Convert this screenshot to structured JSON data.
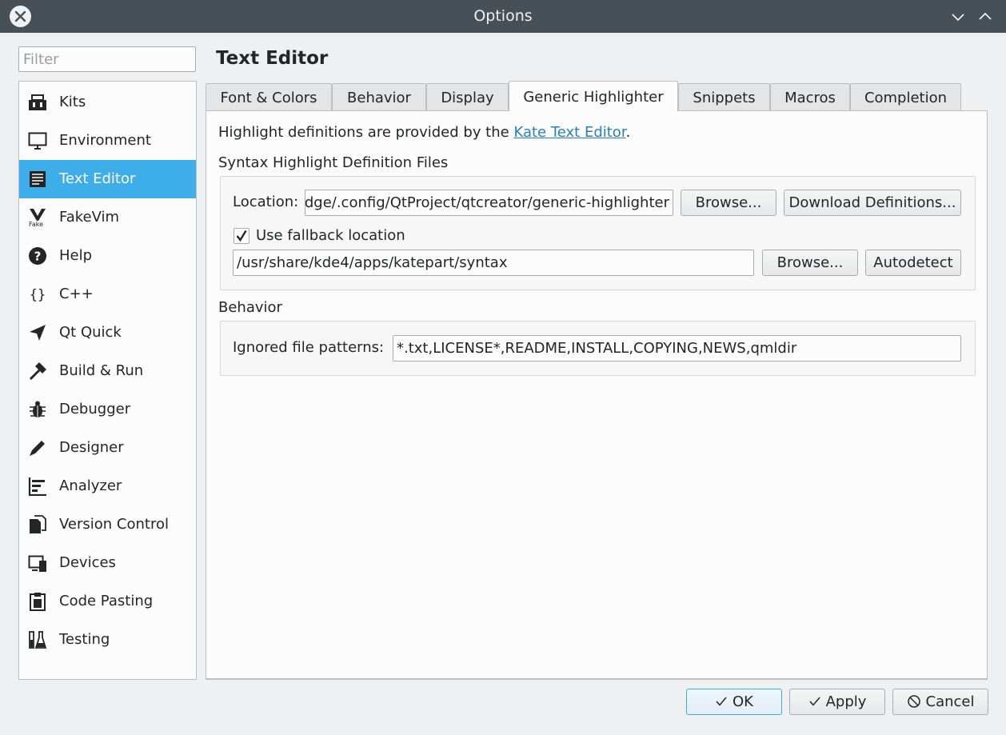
{
  "window": {
    "title": "Options"
  },
  "filter": {
    "placeholder": "Filter",
    "value": ""
  },
  "sidebar": {
    "items": [
      {
        "label": "Kits",
        "icon": "kits-icon"
      },
      {
        "label": "Environment",
        "icon": "monitor-icon"
      },
      {
        "label": "Text Editor",
        "icon": "text-editor-icon",
        "selected": true
      },
      {
        "label": "FakeVim",
        "icon": "fakevim-icon"
      },
      {
        "label": "Help",
        "icon": "help-icon"
      },
      {
        "label": "C++",
        "icon": "braces-icon"
      },
      {
        "label": "Qt Quick",
        "icon": "qtquick-icon"
      },
      {
        "label": "Build & Run",
        "icon": "hammer-icon"
      },
      {
        "label": "Debugger",
        "icon": "bug-icon"
      },
      {
        "label": "Designer",
        "icon": "pen-icon"
      },
      {
        "label": "Analyzer",
        "icon": "analyzer-icon"
      },
      {
        "label": "Version Control",
        "icon": "version-control-icon"
      },
      {
        "label": "Devices",
        "icon": "devices-icon"
      },
      {
        "label": "Code Pasting",
        "icon": "clipboard-icon"
      },
      {
        "label": "Testing",
        "icon": "flask-icon"
      }
    ]
  },
  "page": {
    "title": "Text Editor"
  },
  "tabs": [
    {
      "label": "Font & Colors"
    },
    {
      "label": "Behavior"
    },
    {
      "label": "Display"
    },
    {
      "label": "Generic Highlighter",
      "active": true
    },
    {
      "label": "Snippets"
    },
    {
      "label": "Macros"
    },
    {
      "label": "Completion"
    }
  ],
  "content": {
    "intro_prefix": "Highlight definitions are provided by the ",
    "intro_link": "Kate Text Editor",
    "intro_suffix": ".",
    "syntax_group_title": "Syntax Highlight Definition Files",
    "location_label": "Location:",
    "location_value": "/home/dge/.config/QtProject/qtcreator/generic-highlighter",
    "browse_label": "Browse...",
    "download_label": "Download Definitions...",
    "fallback_checked": true,
    "fallback_label": "Use fallback location",
    "fallback_value": "/usr/share/kde4/apps/katepart/syntax",
    "browse2_label": "Browse...",
    "autodetect_label": "Autodetect",
    "behavior_group_title": "Behavior",
    "ignored_label": "Ignored file patterns:",
    "ignored_value": "*.txt,LICENSE*,README,INSTALL,COPYING,NEWS,qmldir"
  },
  "footer": {
    "ok_label": "OK",
    "apply_label": "Apply",
    "cancel_label": "Cancel"
  },
  "colors": {
    "titlebar": "#475057",
    "selection": "#3daee9",
    "link": "#2980b9",
    "background": "#eff0f1"
  }
}
